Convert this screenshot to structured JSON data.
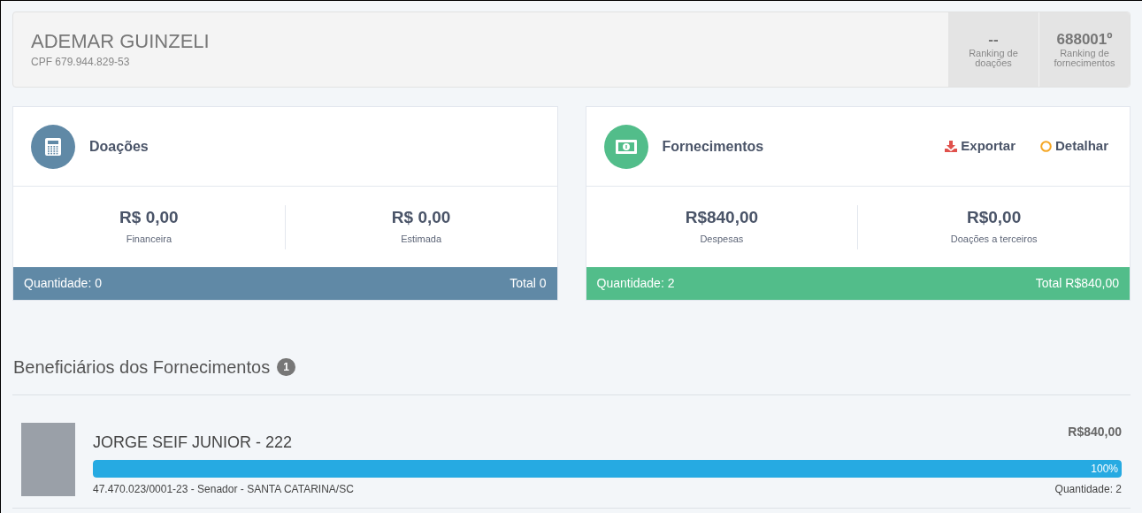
{
  "person": {
    "name": "ADEMAR GUINZELI",
    "document": "CPF 679.944.829-53"
  },
  "rankings": [
    {
      "value": "--",
      "label": "Ranking de doações"
    },
    {
      "value": "688001º",
      "label": "Ranking de fornecimentos"
    }
  ],
  "cards": [
    {
      "kind": "donations",
      "title": "Doações",
      "stats": [
        {
          "value": "R$ 0,00",
          "label": "Financeira"
        },
        {
          "value": "R$ 0,00",
          "label": "Estimada"
        }
      ],
      "footer_left": "Quantidade: 0",
      "footer_right": "Total 0"
    },
    {
      "kind": "supplies",
      "title": "Fornecimentos",
      "actions": [
        {
          "kind": "export",
          "label": "Exportar"
        },
        {
          "kind": "detail",
          "label": "Detalhar"
        }
      ],
      "stats": [
        {
          "value": "R$840,00",
          "label": "Despesas"
        },
        {
          "value": "R$0,00",
          "label": "Doações a terceiros"
        }
      ],
      "footer_left": "Quantidade: 2",
      "footer_right": "Total R$840,00"
    }
  ],
  "beneficiaries": {
    "title": "Beneficiários dos Fornecimentos",
    "count": "1",
    "items": [
      {
        "name": "JORGE SEIF JUNIOR - 222",
        "amount": "R$840,00",
        "level": 1,
        "percent": "100%",
        "details": "47.470.023/0001-23 - Senador - SANTA CATARINA/SC",
        "quantity": "Quantidade: 2"
      }
    ]
  }
}
